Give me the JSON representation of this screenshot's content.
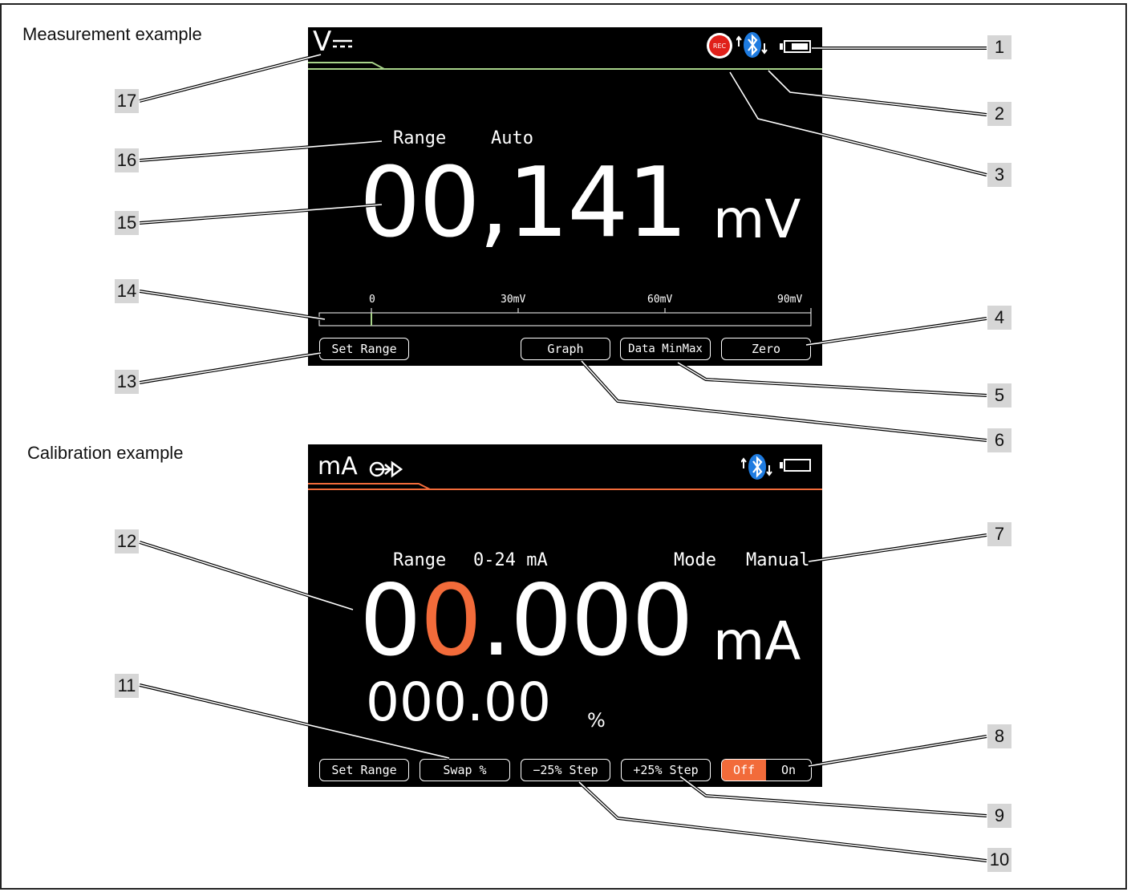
{
  "measurement": {
    "section_title": "Measurement example",
    "mode_symbol": "V",
    "rec_label": "REC",
    "range_label": "Range",
    "range_value": "Auto",
    "reading": "00,141",
    "unit": "mV",
    "scale_ticks": [
      "0",
      "30mV",
      "60mV",
      "90mV"
    ],
    "softkeys": {
      "set_range": "Set Range",
      "graph": "Graph",
      "data_minmax": "Data  MinMax",
      "zero": "Zero"
    },
    "accent_color": "#a8d38a"
  },
  "calibration": {
    "section_title": "Calibration example",
    "mode_symbol": "mA",
    "range_label": "Range",
    "range_value": "0-24 mA",
    "mode_label": "Mode",
    "mode_value": "Manual",
    "reading_first": "0",
    "reading_highlight": "0",
    "reading_rest": ".000",
    "unit": "mA",
    "percent_value": "000.00",
    "percent_unit": "%",
    "softkeys": {
      "set_range": "Set Range",
      "swap": "Swap %",
      "minus_step": "−25% Step",
      "plus_step": "+25% Step",
      "off": "Off",
      "on": "On"
    },
    "accent_color": "#f26b3a"
  },
  "callouts": [
    "1",
    "2",
    "3",
    "4",
    "5",
    "6",
    "7",
    "8",
    "9",
    "10",
    "11",
    "12",
    "13",
    "14",
    "15",
    "16",
    "17"
  ]
}
